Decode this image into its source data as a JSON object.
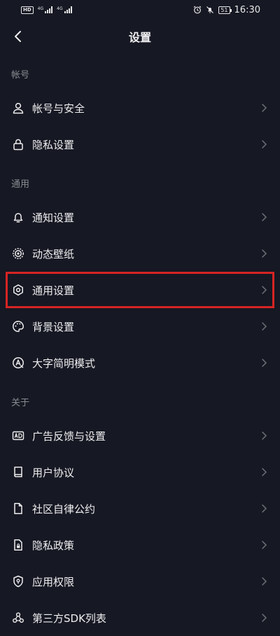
{
  "status_bar": {
    "hd_badge": "HD",
    "signal1_label": "4G",
    "signal2_label": "4G",
    "battery": "51",
    "time": "16:30"
  },
  "nav": {
    "title": "设置"
  },
  "sections": [
    {
      "header": "帐号",
      "items": [
        {
          "label": "帐号与安全",
          "icon": "user-icon"
        },
        {
          "label": "隐私设置",
          "icon": "lock-icon"
        }
      ]
    },
    {
      "header": "通用",
      "items": [
        {
          "label": "通知设置",
          "icon": "bell-icon"
        },
        {
          "label": "动态壁纸",
          "icon": "live-wallpaper-icon"
        },
        {
          "label": "通用设置",
          "icon": "gear-icon",
          "highlighted": true
        },
        {
          "label": "背景设置",
          "icon": "palette-icon"
        },
        {
          "label": "大字简明模式",
          "icon": "large-font-icon"
        }
      ]
    },
    {
      "header": "关于",
      "items": [
        {
          "label": "广告反馈与设置",
          "icon": "ad-icon"
        },
        {
          "label": "用户协议",
          "icon": "book-icon"
        },
        {
          "label": "社区自律公约",
          "icon": "document-icon"
        },
        {
          "label": "隐私政策",
          "icon": "privacy-policy-icon"
        },
        {
          "label": "应用权限",
          "icon": "shield-icon"
        },
        {
          "label": "第三方SDK列表",
          "icon": "sdk-icon"
        }
      ]
    }
  ],
  "colors": {
    "background": "#161823",
    "highlight_border": "#d62424",
    "section_text": "#8a8b91"
  }
}
